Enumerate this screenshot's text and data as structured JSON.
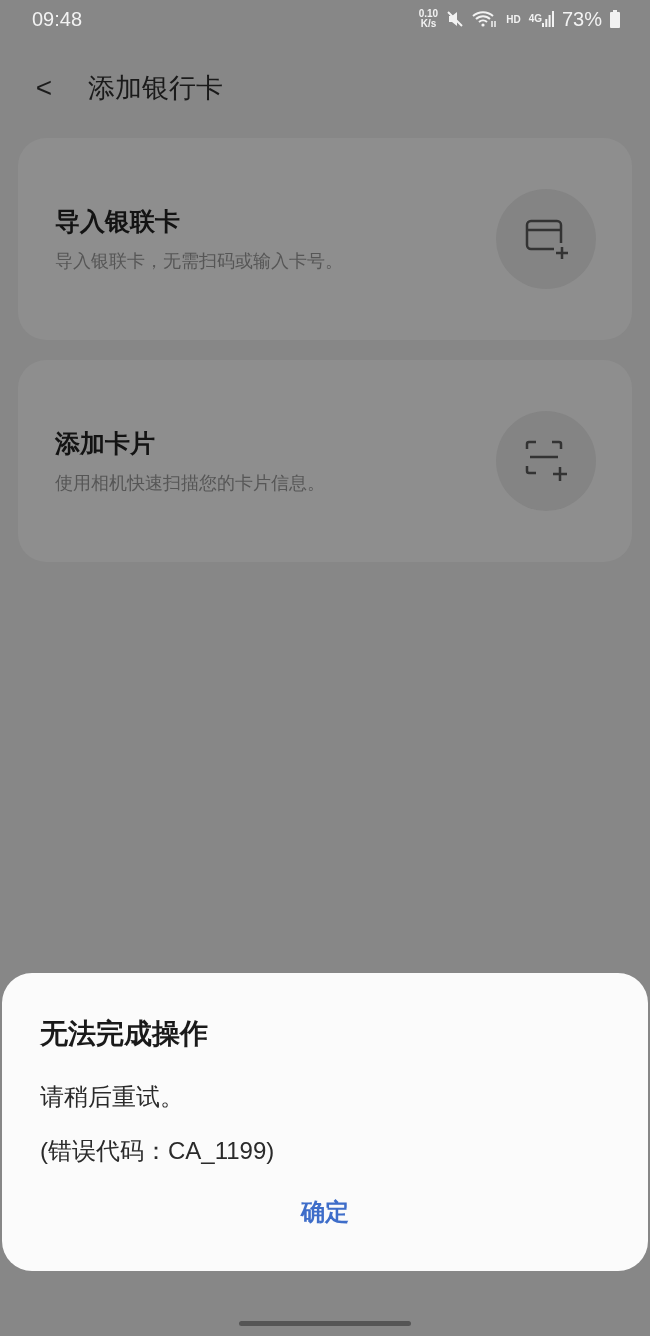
{
  "status_bar": {
    "time": "09:48",
    "speed_value": "0.10",
    "speed_unit": "K/s",
    "hd": "HD",
    "network": "4G",
    "battery": "73%"
  },
  "header": {
    "back": "<",
    "title": "添加银行卡"
  },
  "options": [
    {
      "kind": "card",
      "title": "导入银联卡",
      "subtitle": "导入银联卡，无需扫码或输入卡号。"
    },
    {
      "kind": "scan",
      "title": "添加卡片",
      "subtitle": "使用相机快速扫描您的卡片信息。"
    }
  ],
  "dialog": {
    "title": "无法完成操作",
    "lines": [
      "请稍后重试。",
      "(错误代码：CA_1199)"
    ],
    "button": "确定"
  }
}
